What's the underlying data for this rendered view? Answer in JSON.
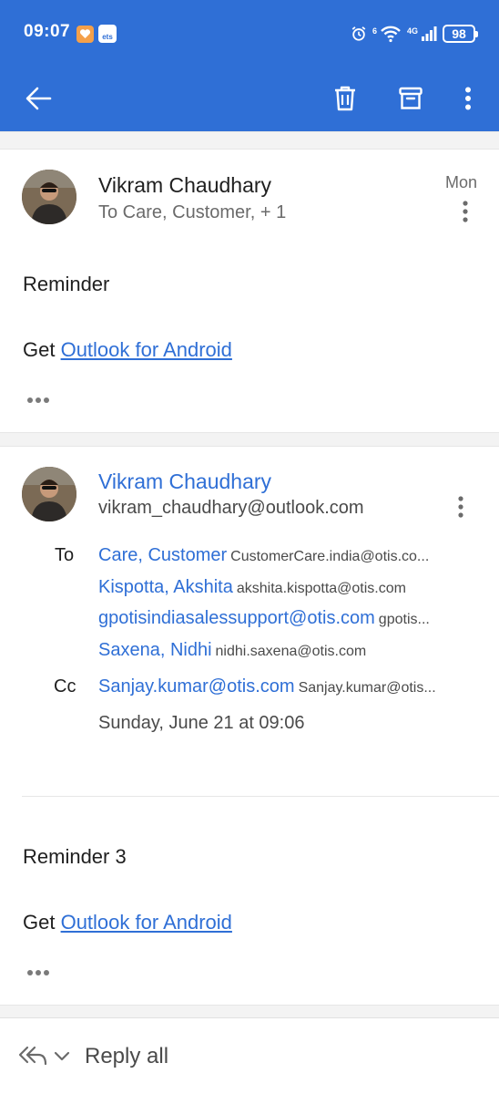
{
  "status_bar": {
    "time": "09:07",
    "network_label": "4G",
    "wifi_label": "6",
    "battery": "98",
    "icons": [
      "notification-app-icon",
      "notification-ets-icon",
      "alarm-icon",
      "wifi-icon",
      "signal-icon",
      "battery-icon"
    ],
    "ets_label": "ets"
  },
  "toolbar": {
    "icons": [
      "back-arrow-icon",
      "delete-icon",
      "archive-icon",
      "more-vertical-icon"
    ]
  },
  "colors": {
    "accent": "#2f6fd6",
    "text": "#1f1f1f",
    "muted": "#6b6b6b"
  },
  "message1": {
    "sender": "Vikram Chaudhary",
    "recipients_summary": "To Care, Customer, + 1",
    "date": "Mon",
    "body_line": "Reminder",
    "footer_prefix": "Get ",
    "footer_link": "Outlook for Android"
  },
  "message2": {
    "sender": "Vikram Chaudhary",
    "sender_email": "vikram_chaudhary@outlook.com",
    "to_label": "To",
    "cc_label": "Cc",
    "to": [
      {
        "name": "Care, Customer",
        "address": "CustomerCare.india@otis.co..."
      },
      {
        "name": "Kispotta, Akshita",
        "address": "akshita.kispotta@otis.com"
      },
      {
        "name": "gpotisindiasalessupport@otis.com",
        "address": "gpotis..."
      },
      {
        "name": "Saxena, Nidhi",
        "address": "nidhi.saxena@otis.com"
      }
    ],
    "cc": [
      {
        "name": "Sanjay.kumar@otis.com",
        "address": "Sanjay.kumar@otis..."
      }
    ],
    "sent_date": "Sunday, June 21 at 09:06",
    "body_line": "Reminder 3",
    "footer_prefix": "Get ",
    "footer_link": "Outlook for Android"
  },
  "reply_bar": {
    "label": "Reply all"
  }
}
